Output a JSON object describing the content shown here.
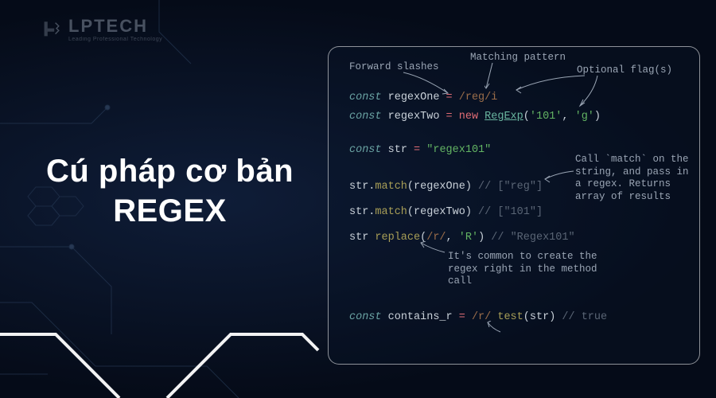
{
  "logo": {
    "brand": "LPTECH",
    "tagline": "Leading Professional Technology"
  },
  "headline": {
    "line1": "Cú pháp cơ bản",
    "line2": "REGEX"
  },
  "annotations": {
    "forward_slashes": "Forward slashes",
    "matching_pattern": "Matching pattern",
    "optional_flags": "Optional flag(s)",
    "call_match": "Call `match` on the string, and pass in a regex.  Returns array of results",
    "common_create": "It's common to create the regex right in the method call"
  },
  "code": {
    "l1_const": "const",
    "l1_ident": " regexOne ",
    "l1_eq": "=",
    "l1_regex": " /reg/",
    "l1_flag": "i",
    "l2_const": "const",
    "l2_ident": " regexTwo ",
    "l2_eq": "=",
    "l2_new": " new ",
    "l2_class": "RegExp",
    "l2_paren_open": "(",
    "l2_arg1": "'101'",
    "l2_comma": ", ",
    "l2_arg2": "'g'",
    "l2_paren_close": ")",
    "l3_const": "const",
    "l3_ident": " str ",
    "l3_eq": "=",
    "l3_str": " \"regex101\"",
    "l4_obj": "str.",
    "l4_method": "match",
    "l4_open": "(",
    "l4_arg": "regexOne",
    "l4_close": ")",
    "l4_comment": " // [\"reg\"]",
    "l5_obj": "str.",
    "l5_method": "match",
    "l5_open": "(",
    "l5_arg": "regexTwo",
    "l5_close": ")",
    "l5_comment": " // [\"101\"]",
    "l6_obj": "str ",
    "l6_method": "replace",
    "l6_open": "(",
    "l6_regex": "/r/",
    "l6_comma": ", ",
    "l6_str": "'R'",
    "l6_close": ")",
    "l6_comment": " // \"Regex101\"",
    "l7_const": "const",
    "l7_ident": " contains_r ",
    "l7_eq": "=",
    "l7_regex": " /r/ ",
    "l7_method": "test",
    "l7_open": "(",
    "l7_arg": "str",
    "l7_close": ")",
    "l7_comment": " // true"
  }
}
